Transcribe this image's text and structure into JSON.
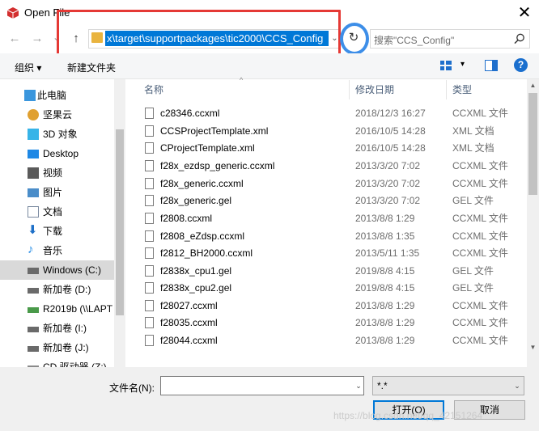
{
  "window": {
    "title": "Open File",
    "close_glyph": "✕",
    "app_icon": "cube-red-icon"
  },
  "nav": {
    "back_glyph": "←",
    "forward_glyph": "→",
    "recent_glyph": "⌄",
    "up_glyph": "↑"
  },
  "address": {
    "path": "x\\target\\supportpackages\\tic2000\\CCS_Config",
    "dropdown_glyph": "⌄",
    "refresh_glyph": "↻"
  },
  "search": {
    "placeholder": "搜索\"CCS_Config\""
  },
  "toolbar": {
    "organize": "组织 ▾",
    "new_folder": "新建文件夹",
    "view_drop": "▾",
    "help": "?"
  },
  "sidebar": {
    "items": [
      {
        "label": "此电脑",
        "icon": "computer-icon",
        "color": "#3a96dd"
      },
      {
        "label": "坚果云",
        "icon": "nutstore-icon",
        "color": "#e0a030"
      },
      {
        "label": "3D 对象",
        "icon": "3d-objects-icon",
        "color": "#37b4e8"
      },
      {
        "label": "Desktop",
        "icon": "desktop-icon",
        "color": "#1e88e5"
      },
      {
        "label": "视频",
        "icon": "video-icon",
        "color": "#5a5a5a"
      },
      {
        "label": "图片",
        "icon": "pictures-icon",
        "color": "#4a8dc9"
      },
      {
        "label": "文档",
        "icon": "documents-icon",
        "color": "#7a8aa0"
      },
      {
        "label": "下载",
        "icon": "downloads-icon",
        "color": "#1e70c8"
      },
      {
        "label": "音乐",
        "icon": "music-icon",
        "color": "#1e88e5"
      },
      {
        "label": "Windows (C:)",
        "icon": "windows-drive-icon",
        "color": "#6a6a6a"
      },
      {
        "label": "新加卷 (D:)",
        "icon": "drive-icon",
        "color": "#6a6a6a"
      },
      {
        "label": "R2019b (\\\\LAPT",
        "icon": "network-drive-icon",
        "color": "#4a9a4a"
      },
      {
        "label": "新加卷 (I:)",
        "icon": "drive-icon",
        "color": "#6a6a6a"
      },
      {
        "label": "新加卷 (J:)",
        "icon": "drive-icon",
        "color": "#6a6a6a"
      },
      {
        "label": "CD 驱动器 (Z:)",
        "icon": "cd-drive-icon",
        "color": "#8a8a8a"
      }
    ]
  },
  "columns": {
    "name": "名称",
    "date": "修改日期",
    "type": "类型",
    "sort_glyph": "^"
  },
  "files": [
    {
      "name": "c28346.ccxml",
      "date": "2018/12/3 16:27",
      "type": "CCXML 文件"
    },
    {
      "name": "CCSProjectTemplate.xml",
      "date": "2016/10/5 14:28",
      "type": "XML 文档"
    },
    {
      "name": "CProjectTemplate.xml",
      "date": "2016/10/5 14:28",
      "type": "XML 文档"
    },
    {
      "name": "f28x_ezdsp_generic.ccxml",
      "date": "2013/3/20 7:02",
      "type": "CCXML 文件"
    },
    {
      "name": "f28x_generic.ccxml",
      "date": "2013/3/20 7:02",
      "type": "CCXML 文件"
    },
    {
      "name": "f28x_generic.gel",
      "date": "2013/3/20 7:02",
      "type": "GEL 文件"
    },
    {
      "name": "f2808.ccxml",
      "date": "2013/8/8 1:29",
      "type": "CCXML 文件"
    },
    {
      "name": "f2808_eZdsp.ccxml",
      "date": "2013/8/8 1:35",
      "type": "CCXML 文件"
    },
    {
      "name": "f2812_BH2000.ccxml",
      "date": "2013/5/11 1:35",
      "type": "CCXML 文件"
    },
    {
      "name": "f2838x_cpu1.gel",
      "date": "2019/8/8 4:15",
      "type": "GEL 文件"
    },
    {
      "name": "f2838x_cpu2.gel",
      "date": "2019/8/8 4:15",
      "type": "GEL 文件"
    },
    {
      "name": "f28027.ccxml",
      "date": "2013/8/8 1:29",
      "type": "CCXML 文件"
    },
    {
      "name": "f28035.ccxml",
      "date": "2013/8/8 1:29",
      "type": "CCXML 文件"
    },
    {
      "name": "f28044.ccxml",
      "date": "2013/8/8 1:29",
      "type": "CCXML 文件"
    }
  ],
  "bottom": {
    "filename_label": "文件名(N):",
    "filename_value": "",
    "filter_value": "*.*",
    "open_button": "打开(O)",
    "cancel_button": "取消",
    "drop_glyph": "⌄"
  },
  "watermark": "https://blog.csdn.net/qq_42151264",
  "colors": {
    "accent": "#0078d7",
    "highlight_red": "#e53935",
    "highlight_blue": "#3d8ee8"
  }
}
